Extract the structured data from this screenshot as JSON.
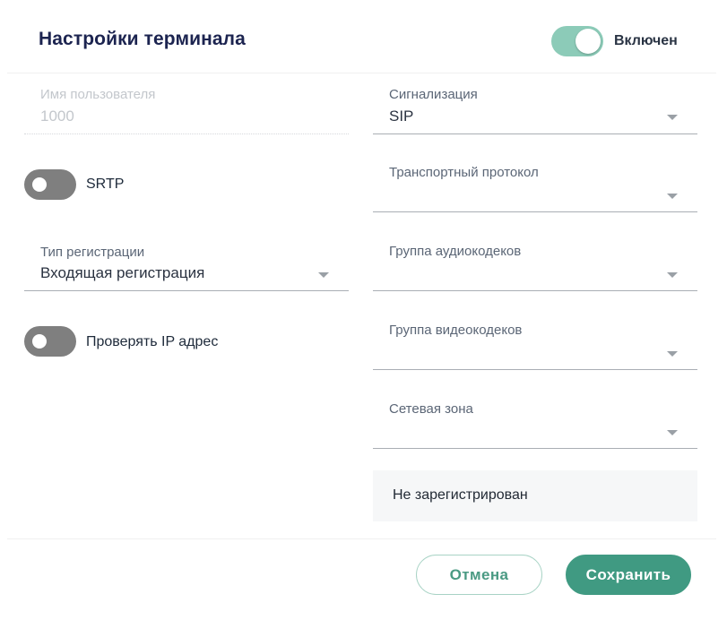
{
  "header": {
    "title": "Настройки терминала",
    "enabled_label": "Включен",
    "enabled": true
  },
  "left": {
    "username": {
      "label": "Имя пользователя",
      "value": "1000",
      "disabled": true
    },
    "srtp": {
      "label": "SRTP",
      "on": false
    },
    "registration_type": {
      "label": "Тип регистрации",
      "value": "Входящая регистрация"
    },
    "check_ip": {
      "label": "Проверять IP адрес",
      "on": false
    }
  },
  "right": {
    "signaling": {
      "label": "Сигнализация",
      "value": "SIP"
    },
    "transport": {
      "label": "Транспортный протокол",
      "value": ""
    },
    "audio_codecs": {
      "label": "Группа аудиокодеков",
      "value": ""
    },
    "video_codecs": {
      "label": "Группа видеокодеков",
      "value": ""
    },
    "network_zone": {
      "label": "Сетевая зона",
      "value": ""
    },
    "status": "Не зарегистрирован"
  },
  "footer": {
    "cancel_label": "Отмена",
    "save_label": "Сохранить"
  },
  "colors": {
    "accent": "#409a82",
    "toggle_on": "#8ccbb8",
    "toggle_off": "#7f7f7f",
    "title": "#1c2450"
  }
}
